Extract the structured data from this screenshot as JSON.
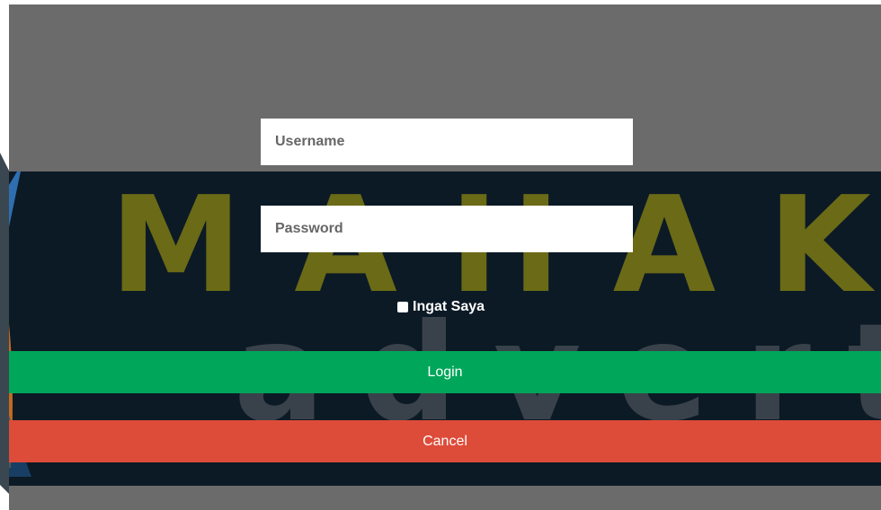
{
  "form": {
    "username_placeholder": "Username",
    "password_placeholder": "Password",
    "remember_label": "Ingat Saya",
    "login_label": "Login",
    "cancel_label": "Cancel"
  },
  "banner": {
    "logo_text": "MAHAKAR",
    "logo_subtext": "advertisi"
  },
  "colors": {
    "overlay": "#6b6b6b",
    "login": "#00a65a",
    "cancel": "#dd4b39",
    "banner_bg": "#0c1a26",
    "logo_text": "#6b6a16"
  }
}
